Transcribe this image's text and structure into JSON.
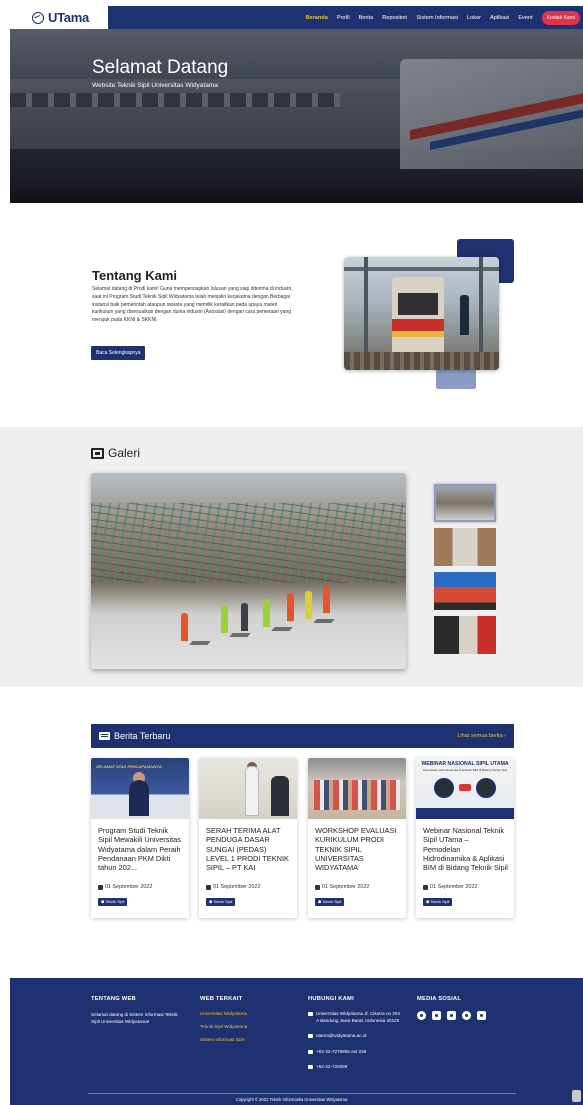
{
  "nav": {
    "brand": "UTama",
    "items": [
      "Beranda",
      "Profil",
      "Berita",
      "Repositori",
      "Sistem Informasi",
      "Loker",
      "Aplikasi",
      "Event"
    ],
    "cta": "Kontak Kami",
    "active_color": "#f2c232",
    "bar_color": "#1e3170"
  },
  "hero": {
    "title": "Selamat Datang",
    "subtitle": "Website Teknik Sipil Universitas Widyatama"
  },
  "about": {
    "title": "Tentang Kami",
    "body": "Selamat datang di Prodi kami! Guna mempersiapkan lulusan yang siap diterima di industri, saat ini Program Studi Teknik Sipil Widyatama telah menjalin kerjasama dengan Berbagai instansi baik pemerintah ataupun swasta yang memilik keraitkan pada upaya materi kurikulum yang disesuaikan dengan dunia industri (Asosiasi) dengan cara pemetaan yang merujuk pada KKNI & SKKNI.",
    "button": "Baca Selengkapnya"
  },
  "gallery": {
    "title": "Galeri"
  },
  "news": {
    "title": "Berita Terbaru",
    "see_all": "Lihat semua berita",
    "cards": [
      {
        "title": "Program Studi Teknik Sipil Mewakili Universitas Widyatama dalam Peraih Pendanaan PKM Dikti tahun 202...",
        "date": "01 September 2022",
        "tag": "Teknik Sipil",
        "image_caption": "SELAMAT ATAS PENCAPAIANNYA"
      },
      {
        "title": "SERAH TERIMA ALAT PENDUGA DASAR SUNGAI (PEDAS) LEVEL 1 PRODI TEKNIK SIPIL – PT KAI",
        "date": "01 September 2022",
        "tag": "Teknik Sipil"
      },
      {
        "title": "WORKSHOP EVALUASI KURIKULUM PRODI TEKNIK SIPIL UNIVERSITAS WIDYATAMA",
        "date": "01 September 2022",
        "tag": "Teknik Sipil"
      },
      {
        "title": "Webinar Nasional Teknik Sipil UTama – Pemodelan Hidrodinamika & Aplikasi BIM di Bidang Teknik Sipil",
        "date": "01 September 2022",
        "tag": "Teknik Sipil",
        "image_caption": "WEBINAR NASIONAL SIPIL UTAMA",
        "image_subcaption": "Pemodelan Hidrodinamika & Aplikasi BIM di Bidang Teknik Sipil"
      }
    ]
  },
  "footer": {
    "web_heading": "TENTANG WEB",
    "web_text": "Selamat datang di Sistem Informasi Teknik Sipil Universitas Widyatama!",
    "links_heading": "WEB TERKAIT",
    "links": [
      "Universitas Widyatama",
      "Teknik Sipil Widyatama",
      "Sistem Informasi SDA"
    ],
    "contact_heading": "HUBUNGI KAMI",
    "address": "Universitas Widyatama Jl. Cikutra no 204 A Bandung Jawa Barat, Indonesia 40125",
    "email": "utama@widyatama.ac.id",
    "phone": "+62-22-7275855 ext 228",
    "fax": "+62-22-720299",
    "social_heading": "MEDIA SOSIAL",
    "social": [
      "facebook-icon",
      "twitter-icon",
      "linkedin-icon",
      "instagram-icon",
      "youtube-icon"
    ],
    "copyright": "Copyright © 2022 Teknik Informatika Universitas Widyatama"
  }
}
